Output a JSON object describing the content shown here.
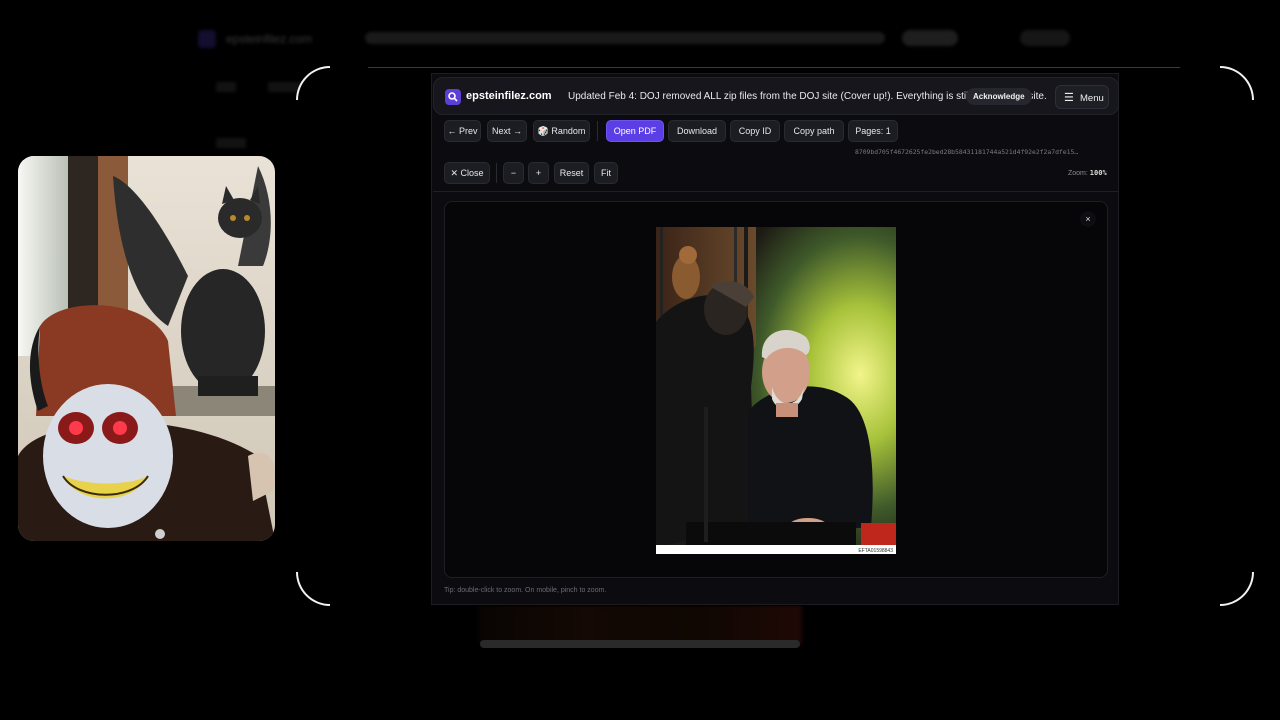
{
  "header": {
    "site_name": "epsteinfilez.com",
    "notice": "Updated Feb 4: DOJ removed ALL zip files from the DOJ site (Cover up!). Everything is still here on this site.",
    "acknowledge_label": "Acknowledge",
    "menu_label": "Menu"
  },
  "toolbar": {
    "prev_label": "← Prev",
    "next_label": "Next →",
    "random_label": "🎲 Random",
    "open_pdf_label": "Open PDF",
    "download_label": "Download",
    "copy_id_label": "Copy ID",
    "copy_path_label": "Copy path",
    "pages_label": "Pages: 1"
  },
  "file_hash": "8709bd705f4672625fe2bed28b58431181744a521d4f92e2f2a7dfe15…",
  "zoom_toolbar": {
    "close_label": "✕ Close",
    "zoom_out_label": "−",
    "zoom_in_label": "+",
    "reset_label": "Reset",
    "fit_label": "Fit",
    "zoom_prefix": "Zoom:",
    "zoom_value": "100%"
  },
  "viewer": {
    "close_icon_label": "×",
    "document_id": "EFTA01598843"
  },
  "tip": "Tip: double-click to zoom. On mobile, pinch to zoom.",
  "background_page": {
    "site_name": "epsteinfilez.com"
  },
  "colors": {
    "accent": "#5b3ee6",
    "app_bg": "#0c0c10",
    "frame_corner": "#f2f2f2"
  }
}
